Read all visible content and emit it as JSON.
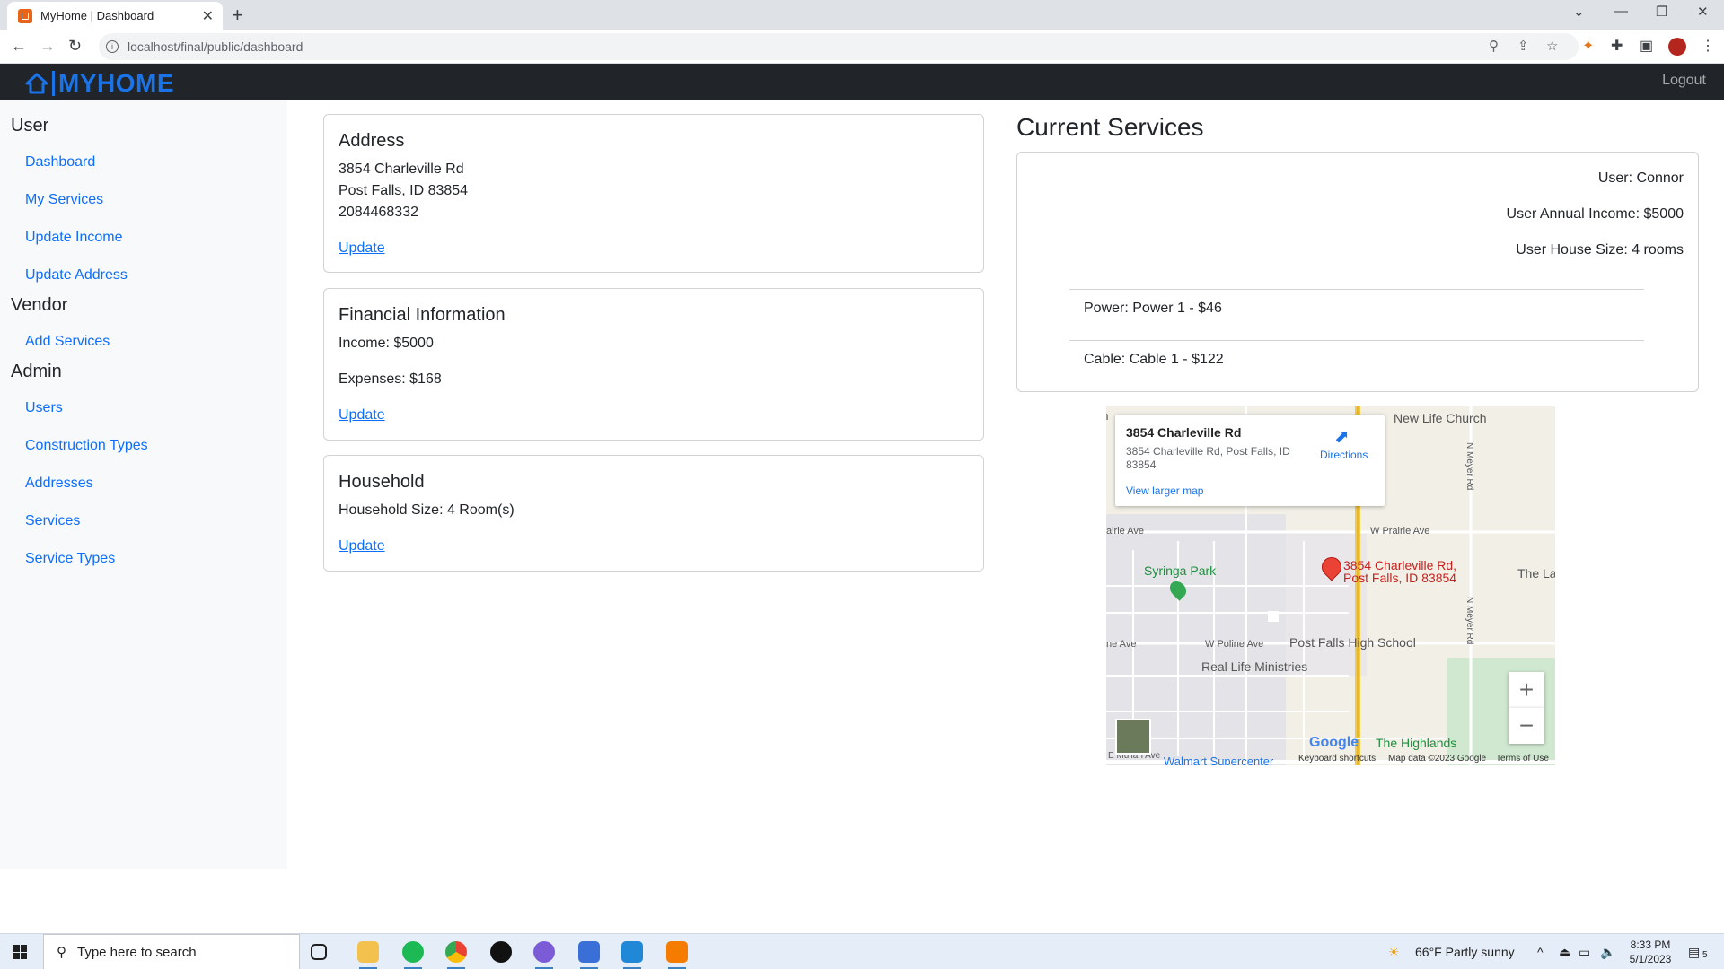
{
  "browser": {
    "tab_title": "MyHome | Dashboard",
    "url": "localhost/final/public/dashboard"
  },
  "navbar": {
    "brand": "MYHOME",
    "logout_label": "Logout"
  },
  "sidebar": {
    "sections": [
      {
        "heading": "User",
        "items": [
          "Dashboard",
          "My Services",
          "Update Income",
          "Update Address"
        ]
      },
      {
        "heading": "Vendor",
        "items": [
          "Add Services"
        ]
      },
      {
        "heading": "Admin",
        "items": [
          "Users",
          "Construction Types",
          "Addresses",
          "Services",
          "Service Types"
        ]
      }
    ]
  },
  "address_card": {
    "title": "Address",
    "line1": "3854 Charleville Rd",
    "line2": "Post Falls, ID 83854",
    "phone": "2084468332",
    "update_label": "Update"
  },
  "financial_card": {
    "title": "Financial Information",
    "income": "Income: $5000",
    "expenses": "Expenses: $168",
    "update_label": "Update"
  },
  "household_card": {
    "title": "Household",
    "size": "Household Size: 4 Room(s)",
    "update_label": "Update"
  },
  "services": {
    "title": "Current Services",
    "user": "User: Connor",
    "income": "User Annual Income: $5000",
    "house_size": "User House Size: 4 rooms",
    "items": [
      "Power: Power 1 - $46",
      "Cable: Cable 1 - $122"
    ]
  },
  "map": {
    "popup_title": "3854 Charleville Rd",
    "popup_address": "3854 Charleville Rd, Post Falls, ID 83854",
    "directions_label": "Directions",
    "larger_map_label": "View larger map",
    "pin_label_1": "3854 Charleville Rd,",
    "pin_label_2": "Post Falls, ID 83854",
    "places": {
      "new_life_church": "New Life Church",
      "syringa_park": "Syringa Park",
      "post_falls_hs": "Post Falls High School",
      "real_life": "Real Life Ministries",
      "highlands": "The Highlands",
      "walmart": "Walmart Supercenter",
      "the_la": "The La"
    },
    "streets": {
      "w_prairie": "W Prairie Ave",
      "prairie_left": "airie Ave",
      "w_poline": "W Poline Ave",
      "poline_left": "ne Ave",
      "n_meyer_1": "N Meyer Rd",
      "n_meyer_2": "N Meyer Rd",
      "mullan": "E Mullan Ave"
    },
    "google": "Google",
    "keyboard": "Keyboard shortcuts",
    "map_data": "Map data ©2023 Google",
    "terms": "Terms of Use",
    "zoom_in": "+",
    "zoom_out": "−"
  },
  "taskbar": {
    "search_placeholder": "Type here to search",
    "weather": "66°F  Partly sunny",
    "time": "8:33 PM",
    "date": "5/1/2023",
    "notifications": "5"
  }
}
